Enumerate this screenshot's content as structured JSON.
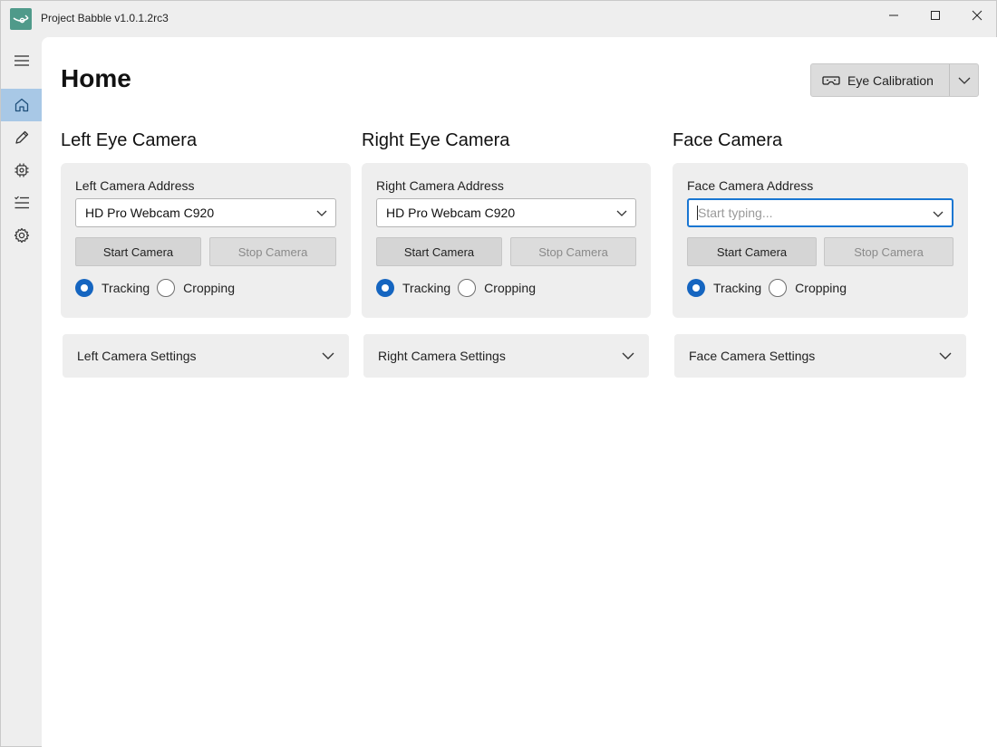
{
  "window": {
    "title": "Project Babble v1.0.1.2rc3"
  },
  "colors": {
    "accent": "#1565c0",
    "logo": "#4f9a8a",
    "sidebar_selected": "#a8c8e6"
  },
  "sidebar": {
    "items": [
      {
        "name": "menu",
        "icon": "hamburger-icon"
      },
      {
        "name": "home",
        "icon": "home-icon",
        "selected": true
      },
      {
        "name": "edit",
        "icon": "pencil-icon"
      },
      {
        "name": "hardware",
        "icon": "chip-icon"
      },
      {
        "name": "list",
        "icon": "list-icon"
      },
      {
        "name": "settings",
        "icon": "gear-icon"
      }
    ]
  },
  "main": {
    "title": "Home",
    "calibration_button": {
      "label": "Eye Calibration",
      "icon": "vr-headset-icon"
    },
    "cameras": [
      {
        "heading": "Left Eye Camera",
        "address_label": "Left Camera Address",
        "address_value": "HD Pro Webcam C920",
        "address_placeholder": "",
        "start_label": "Start Camera",
        "stop_label": "Stop Camera",
        "radio_tracking": "Tracking",
        "radio_cropping": "Cropping",
        "selected_mode": "Tracking",
        "settings_label": "Left Camera Settings"
      },
      {
        "heading": "Right Eye Camera",
        "address_label": "Right Camera Address",
        "address_value": "HD Pro Webcam C920",
        "address_placeholder": "",
        "start_label": "Start Camera",
        "stop_label": "Stop Camera",
        "radio_tracking": "Tracking",
        "radio_cropping": "Cropping",
        "selected_mode": "Tracking",
        "settings_label": "Right Camera Settings"
      },
      {
        "heading": "Face Camera",
        "address_label": "Face Camera Address",
        "address_value": "",
        "address_placeholder": "Start typing...",
        "start_label": "Start Camera",
        "stop_label": "Stop Camera",
        "radio_tracking": "Tracking",
        "radio_cropping": "Cropping",
        "selected_mode": "Tracking",
        "settings_label": "Face Camera Settings"
      }
    ]
  }
}
